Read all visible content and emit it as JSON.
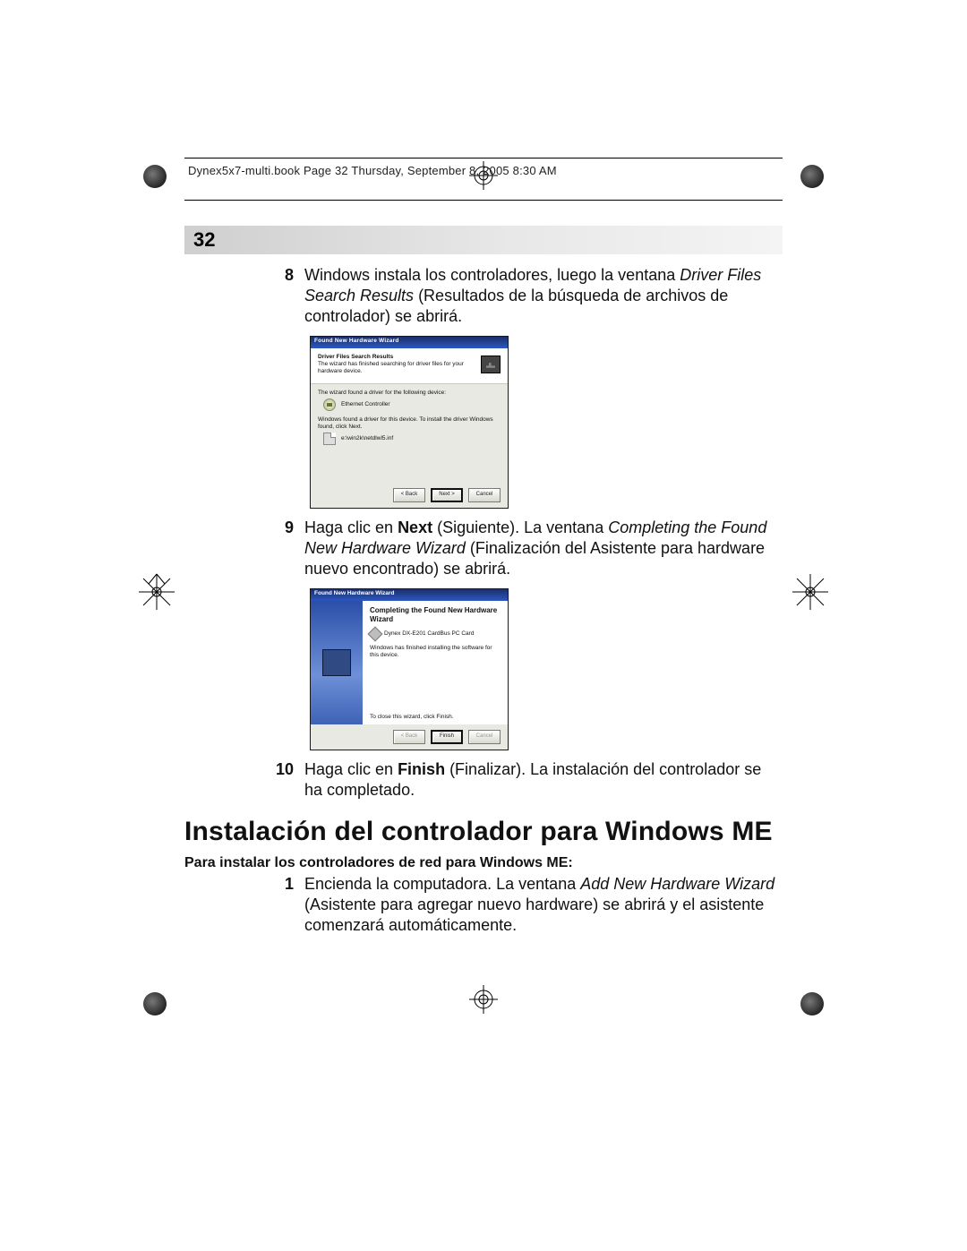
{
  "header": {
    "running": "Dynex5x7-multi.book  Page 32  Thursday, September 8, 2005  8:30 AM"
  },
  "page_number": "32",
  "step8": {
    "num": "8",
    "text_before": "Windows instala los controladores, luego la ventana ",
    "italic": "Driver Files Search Results",
    "text_after": "  (Resultados de la búsqueda de archivos de controlador) se abrirá."
  },
  "dialog1": {
    "title": "Found New Hardware Wizard",
    "hdr_bold": "Driver Files Search Results",
    "hdr_sub": "The wizard has finished searching for driver files for your hardware device.",
    "line1": "The wizard found a driver for the following device:",
    "device": "Ethernet Controller",
    "line2": "Windows found a driver for this device. To install the driver Windows found, click Next.",
    "path": "e:\\win2k\\netdlwl5.inf",
    "btn_back": "< Back",
    "btn_next": "Next >",
    "btn_cancel": "Cancel"
  },
  "step9": {
    "num": "9",
    "pre": "Haga clic en ",
    "bold1": "Next",
    "mid1": " (Siguiente). La ventana  ",
    "italic": "Completing the Found New Hardware Wizard",
    "mid2": " (Finalización del Asistente para hardware nuevo encontrado) se abrirá."
  },
  "dialog2": {
    "title": "Found New Hardware Wizard",
    "big": "Completing the Found New Hardware Wizard",
    "device": "Dynex DX-E201 CardBus PC Card",
    "line1": "Windows has finished installing the software for this device.",
    "closing": "To close this wizard, click Finish.",
    "btn_back": "< Back",
    "btn_finish": "Finish",
    "btn_cancel": "Cancel"
  },
  "step10": {
    "num": "10",
    "pre": "Haga clic en ",
    "bold1": "Finish",
    "post": " (Finalizar). La instalación del controlador se ha completado."
  },
  "section_heading": "Instalación del controlador para Windows ME",
  "subheading": "Para instalar los controladores de red para Windows ME:",
  "step_me1": {
    "num": "1",
    "pre": "Encienda la computadora. La ventana ",
    "italic": "Add New Hardware Wizard",
    "post": "  (Asistente para agregar nuevo hardware) se abrirá y el asistente comenzará automáticamente."
  }
}
